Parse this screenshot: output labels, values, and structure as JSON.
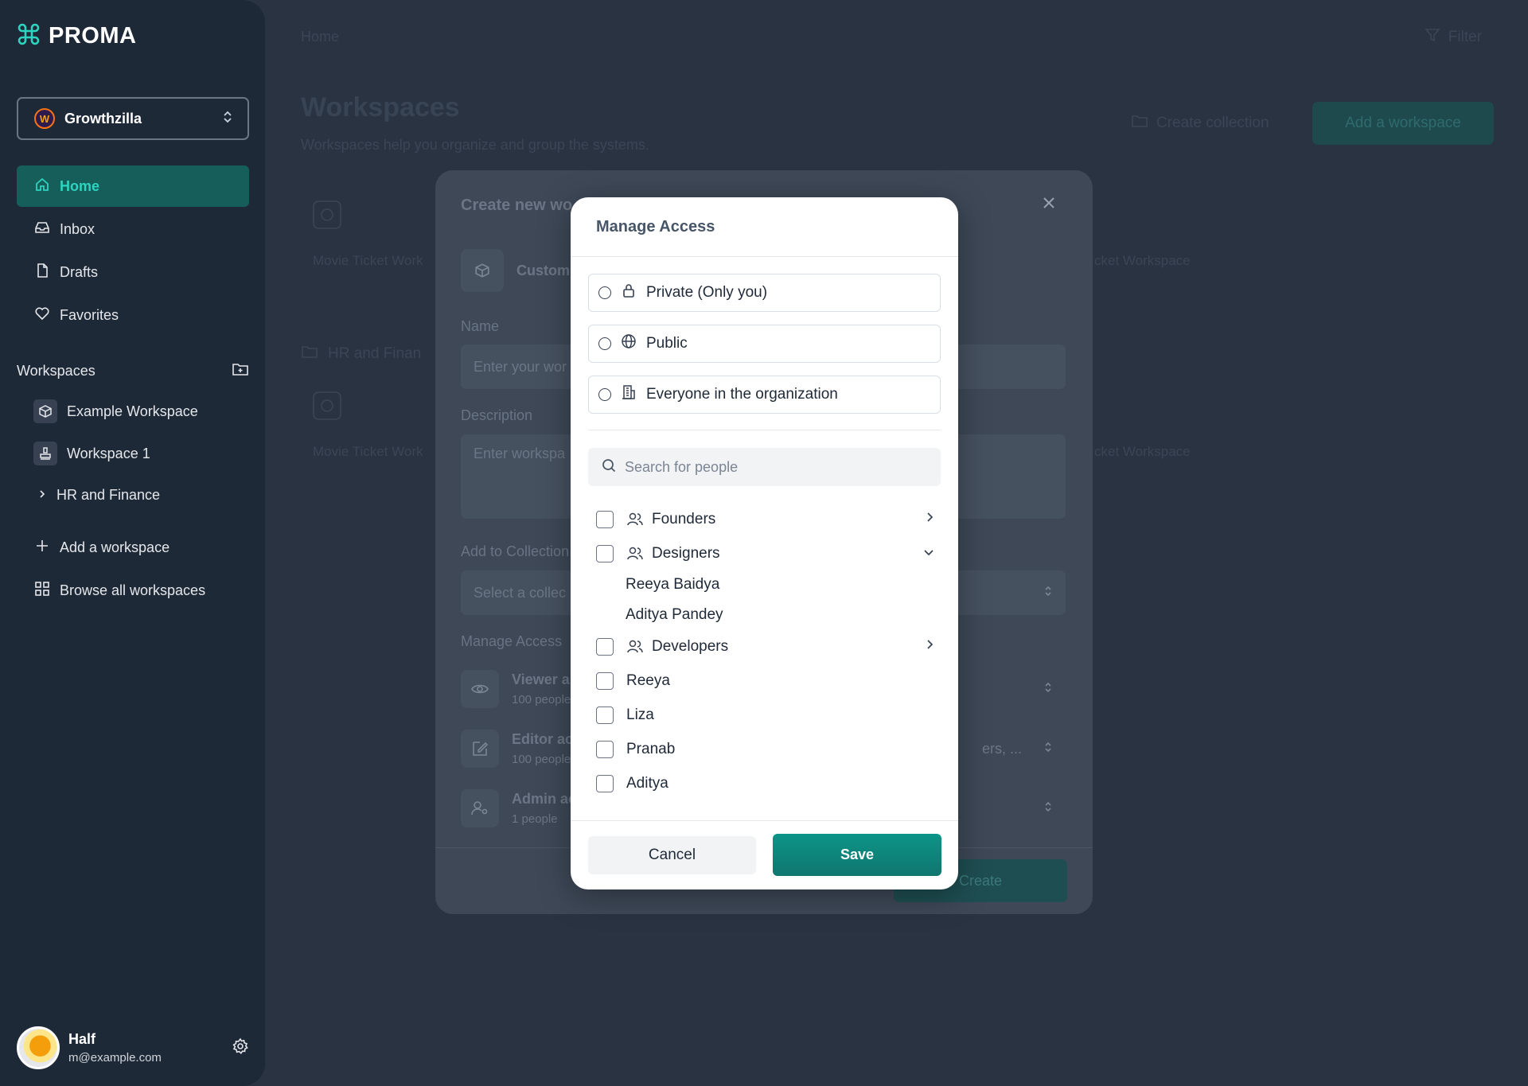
{
  "app": {
    "logo_text": "PROMA"
  },
  "sidebar": {
    "org_name": "Growthzilla",
    "org_initial": "W",
    "nav": [
      {
        "label": "Home",
        "icon": "home-icon",
        "active": true
      },
      {
        "label": "Inbox",
        "icon": "inbox-icon"
      },
      {
        "label": "Drafts",
        "icon": "file-icon"
      },
      {
        "label": "Favorites",
        "icon": "heart-icon"
      }
    ],
    "workspaces_heading": "Workspaces",
    "workspaces": [
      {
        "label": "Example Workspace",
        "icon": "cube-icon"
      },
      {
        "label": "Workspace 1",
        "icon": "stamp-icon"
      },
      {
        "label": "HR and Finance",
        "icon": "chevron-right-icon"
      }
    ],
    "add_workspace": "Add a workspace",
    "browse_all": "Browse all workspaces",
    "user": {
      "name": "Half",
      "email": "m@example.com"
    }
  },
  "background": {
    "breadcrumb": "Home",
    "filter_label": "Filter",
    "title": "Workspaces",
    "subtitle": "Workspaces help you organize and group the systems.",
    "create_collection": "Create collection",
    "add_workspace_button": "Add a workspace",
    "card_a": "Movie Ticket Work",
    "card_b": "cket Workspace",
    "folder_label": "HR and Finan",
    "card_c": "Movie Ticket Work",
    "card_d": "cket Workspace"
  },
  "create_modal": {
    "title": "Create new wo",
    "custom_label": "Custom",
    "name_label": "Name",
    "name_placeholder": "Enter your wor",
    "description_label": "Description",
    "description_placeholder": "Enter workspa",
    "collection_label": "Add to Collection",
    "collection_placeholder": "Select a collec",
    "manage_access_label": "Manage Access",
    "access_rows": [
      {
        "title": "Viewer a",
        "sub": "100 people",
        "icon": "eye-icon"
      },
      {
        "title": "Editor ac",
        "sub": "100 people",
        "icon": "edit-icon",
        "value": "ers, ..."
      },
      {
        "title": "Admin ac",
        "sub": "1 people",
        "icon": "user-cog-icon"
      }
    ],
    "create_button": "Create"
  },
  "access_modal": {
    "title": "Manage Access",
    "options": [
      {
        "label": "Private (Only you)",
        "icon": "lock-icon"
      },
      {
        "label": "Public",
        "icon": "globe-icon"
      },
      {
        "label": "Everyone in the organization",
        "icon": "building-icon"
      }
    ],
    "search_placeholder": "Search for people",
    "groups": [
      {
        "label": "Founders",
        "expanded": false
      },
      {
        "label": "Designers",
        "expanded": true,
        "members": [
          "Reeya Baidya",
          "Aditya Pandey"
        ]
      },
      {
        "label": "Developers",
        "expanded": false
      }
    ],
    "people": [
      "Reeya",
      "Liza",
      "Pranab",
      "Aditya"
    ],
    "cancel_label": "Cancel",
    "save_label": "Save"
  },
  "colors": {
    "accent": "#0d9488",
    "sidebar_bg": "#1e2937",
    "active_text": "#2dd4bf"
  }
}
